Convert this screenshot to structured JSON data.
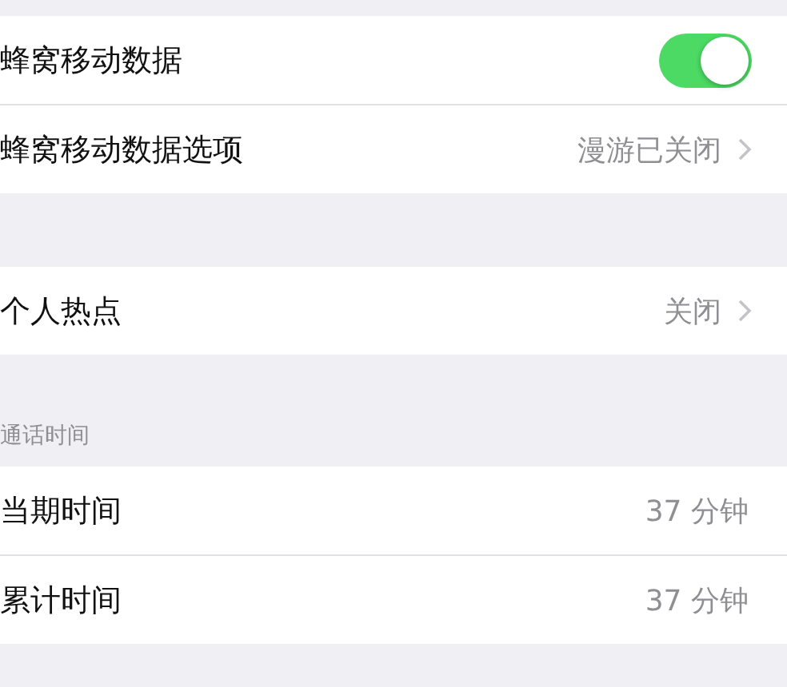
{
  "sections": [
    {
      "rows": [
        {
          "kind": "toggle",
          "label": "蜂窝移动数据",
          "on": true
        },
        {
          "kind": "disclosure",
          "label": "蜂窝移动数据选项",
          "value": "漫游已关闭"
        }
      ]
    },
    {
      "rows": [
        {
          "kind": "disclosure",
          "label": "个人热点",
          "value": "关闭"
        }
      ]
    },
    {
      "header": "通话时间",
      "rows": [
        {
          "kind": "value",
          "label": "当期时间",
          "value": "37 分钟"
        },
        {
          "kind": "value",
          "label": "累计时间",
          "value": "37 分钟"
        }
      ]
    }
  ]
}
